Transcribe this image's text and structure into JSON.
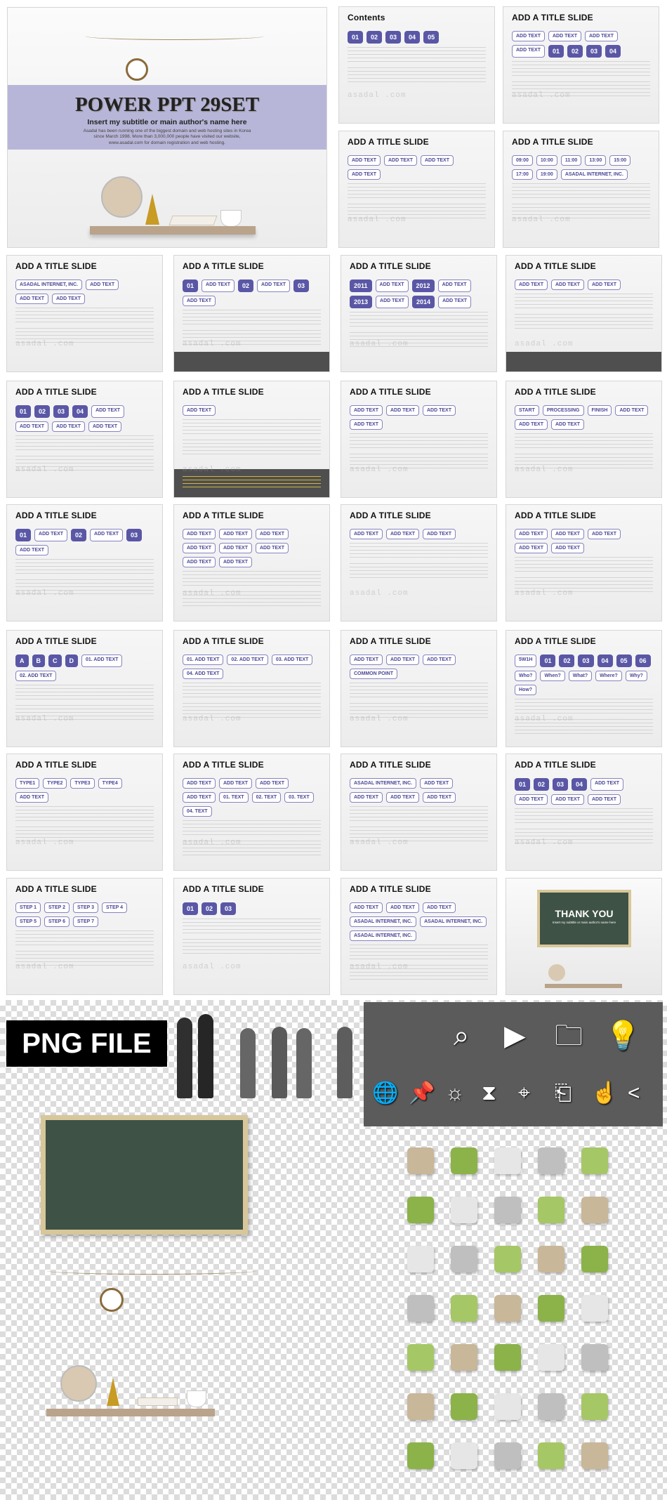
{
  "watermark": "asadal .com",
  "title_slide": {
    "title": "POWER PPT 29SET",
    "subtitle": "Insert my subtitle or main author's name here",
    "description": "Asadal has been running one of the biggest domain and web hosting sites in Korea since March 1998. More than 3,000,000 people have visited our website, www.asadal.com for domain registration and web hosting."
  },
  "slides": [
    {
      "title": "Contents",
      "labels": [
        "01",
        "02",
        "03",
        "04",
        "05"
      ],
      "band": false
    },
    {
      "title": "ADD A TITLE SLIDE",
      "labels": [
        "ADD TEXT",
        "ADD TEXT",
        "ADD TEXT",
        "ADD TEXT",
        "01",
        "02",
        "03",
        "04"
      ],
      "band": false
    },
    {
      "title": "ADD A TITLE SLIDE",
      "labels": [
        "ADD TEXT",
        "ADD TEXT",
        "ADD TEXT",
        "ADD TEXT"
      ],
      "band": false
    },
    {
      "title": "ADD A TITLE SLIDE",
      "labels": [
        "09:00",
        "10:00",
        "11:00",
        "13:00",
        "15:00",
        "17:00",
        "19:00",
        "ASADAL INTERNET, INC."
      ],
      "band": false
    },
    {
      "title": "ADD A TITLE SLIDE",
      "labels": [
        "ASADAL INTERNET, INC.",
        "ADD TEXT",
        "ADD TEXT",
        "ADD TEXT"
      ],
      "band": false
    },
    {
      "title": "ADD A TITLE SLIDE",
      "labels": [
        "01",
        "ADD TEXT",
        "02",
        "ADD TEXT",
        "03",
        "ADD TEXT"
      ],
      "band": true
    },
    {
      "title": "ADD A TITLE SLIDE",
      "labels": [
        "2011",
        "ADD TEXT",
        "2012",
        "ADD TEXT",
        "2013",
        "ADD TEXT",
        "2014",
        "ADD TEXT"
      ],
      "band": false
    },
    {
      "title": "ADD A TITLE SLIDE",
      "labels": [
        "ADD TEXT",
        "ADD TEXT",
        "ADD TEXT"
      ],
      "band": true
    },
    {
      "title": "ADD A TITLE SLIDE",
      "labels": [
        "01",
        "02",
        "03",
        "04",
        "ADD TEXT",
        "ADD TEXT",
        "ADD TEXT",
        "ADD TEXT"
      ],
      "band": false
    },
    {
      "title": "ADD A TITLE SLIDE",
      "labels": [
        "ADD TEXT"
      ],
      "band": "yellow"
    },
    {
      "title": "ADD A TITLE SLIDE",
      "labels": [
        "ADD TEXT",
        "ADD TEXT",
        "ADD TEXT",
        "ADD TEXT"
      ],
      "band": false
    },
    {
      "title": "ADD A TITLE SLIDE",
      "labels": [
        "START",
        "PROCESSING",
        "FINISH",
        "ADD TEXT",
        "ADD TEXT",
        "ADD TEXT"
      ],
      "band": false
    },
    {
      "title": "ADD A TITLE SLIDE",
      "labels": [
        "01",
        "ADD TEXT",
        "02",
        "ADD TEXT",
        "03",
        "ADD TEXT"
      ],
      "band": false
    },
    {
      "title": "ADD A TITLE SLIDE",
      "labels": [
        "ADD TEXT",
        "ADD TEXT",
        "ADD TEXT",
        "ADD TEXT",
        "ADD TEXT",
        "ADD TEXT",
        "ADD TEXT",
        "ADD TEXT"
      ],
      "band": false
    },
    {
      "title": "ADD A TITLE SLIDE",
      "labels": [
        "ADD TEXT",
        "ADD TEXT",
        "ADD TEXT"
      ],
      "band": false
    },
    {
      "title": "ADD A TITLE SLIDE",
      "labels": [
        "ADD TEXT",
        "ADD TEXT",
        "ADD TEXT",
        "ADD TEXT",
        "ADD TEXT"
      ],
      "band": false
    },
    {
      "title": "ADD A TITLE SLIDE",
      "labels": [
        "A",
        "B",
        "C",
        "D",
        "01. ADD TEXT",
        "02. ADD TEXT"
      ],
      "band": false
    },
    {
      "title": "ADD A TITLE SLIDE",
      "labels": [
        "01. ADD TEXT",
        "02. ADD TEXT",
        "03. ADD TEXT",
        "04. ADD TEXT"
      ],
      "band": false
    },
    {
      "title": "ADD A TITLE SLIDE",
      "labels": [
        "ADD TEXT",
        "ADD TEXT",
        "ADD TEXT",
        "COMMON POINT"
      ],
      "band": false
    },
    {
      "title": "ADD A TITLE SLIDE",
      "labels": [
        "5W1H",
        "01",
        "02",
        "03",
        "04",
        "05",
        "06",
        "Who?",
        "When?",
        "What?",
        "Where?",
        "Why?",
        "How?"
      ],
      "band": false
    },
    {
      "title": "ADD A TITLE SLIDE",
      "labels": [
        "TYPE1",
        "TYPE2",
        "TYPE3",
        "TYPE4",
        "ADD TEXT"
      ],
      "band": false
    },
    {
      "title": "ADD A TITLE SLIDE",
      "labels": [
        "ADD TEXT",
        "ADD TEXT",
        "ADD TEXT",
        "ADD TEXT",
        "01. TEXT",
        "02. TEXT",
        "03. TEXT",
        "04. TEXT"
      ],
      "band": false
    },
    {
      "title": "ADD A TITLE SLIDE",
      "labels": [
        "ASADAL INTERNET, INC.",
        "ADD TEXT",
        "ADD TEXT",
        "ADD TEXT",
        "ADD TEXT"
      ],
      "band": false
    },
    {
      "title": "ADD A TITLE SLIDE",
      "labels": [
        "01",
        "02",
        "03",
        "04",
        "ADD TEXT",
        "ADD TEXT",
        "ADD TEXT",
        "ADD TEXT"
      ],
      "band": false
    },
    {
      "title": "ADD A TITLE SLIDE",
      "labels": [
        "STEP 1",
        "STEP 2",
        "STEP 3",
        "STEP 4",
        "STEP 5",
        "STEP 6",
        "STEP 7"
      ],
      "band": false
    },
    {
      "title": "ADD A TITLE SLIDE",
      "labels": [
        "01",
        "02",
        "03"
      ],
      "band": false
    },
    {
      "title": "ADD A TITLE SLIDE",
      "labels": [
        "ADD TEXT",
        "ADD TEXT",
        "ADD TEXT",
        "ASADAL INTERNET, INC.",
        "ASADAL INTERNET, INC.",
        "ASADAL INTERNET, INC."
      ],
      "band": false
    }
  ],
  "thank_you": {
    "title": "THANK YOU",
    "subtitle": "Insert my subtitle or main author's name here"
  },
  "png_section": {
    "label": "PNG FILE",
    "panel_icons": [
      "chart-search-icon",
      "play-icon",
      "folder-icon",
      "idea-bulb-icon",
      "globe-icon",
      "pushpin-icon",
      "lightbulb-icon",
      "hourglass-icon",
      "location-pin-icon",
      "exit-icon",
      "pointing-hand-icon",
      "share-icon"
    ]
  },
  "colors": {
    "accent": "#5a57a6",
    "band": "#b8b6d8",
    "dark": "#4f4f4f"
  }
}
